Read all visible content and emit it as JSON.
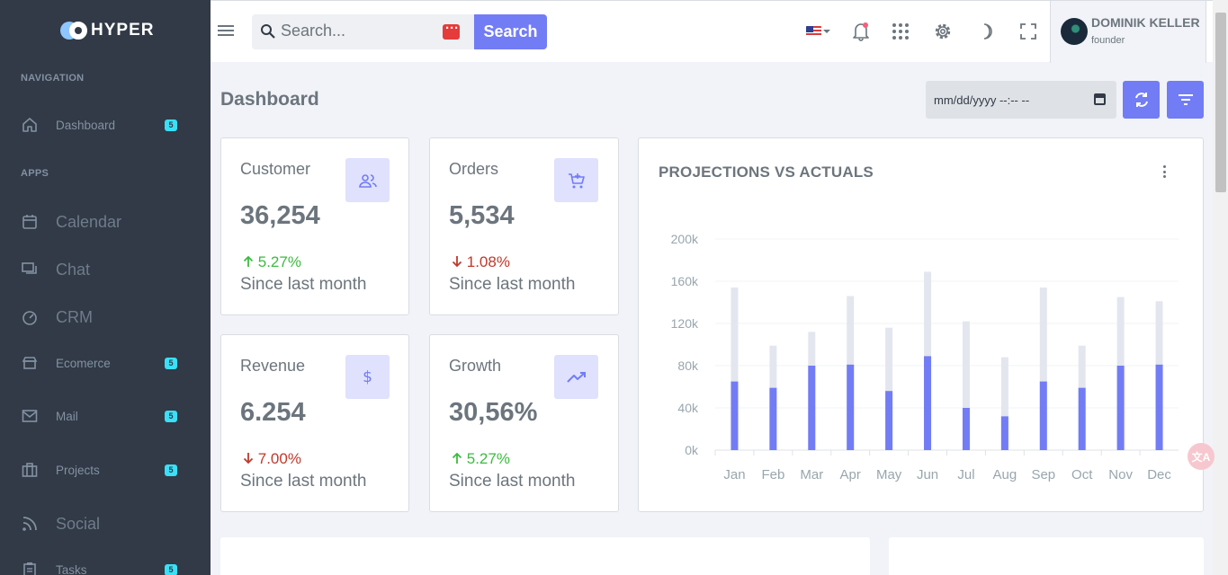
{
  "app": {
    "name": "HYPER"
  },
  "sidebar": {
    "sections": [
      "NAVIGATION",
      "APPS"
    ],
    "items": [
      {
        "label": "Dashboard",
        "icon": "home-icon",
        "badge": "5"
      },
      {
        "label": "Calendar",
        "icon": "calendar-icon"
      },
      {
        "label": "Chat",
        "icon": "chat-icon"
      },
      {
        "label": "CRM",
        "icon": "speedometer-icon"
      },
      {
        "label": "Ecomerce",
        "icon": "store-icon",
        "badge": "5"
      },
      {
        "label": "Mail",
        "icon": "mail-icon",
        "badge": "5"
      },
      {
        "label": "Projects",
        "icon": "briefcase-icon",
        "badge": "5"
      },
      {
        "label": "Social",
        "icon": "rss-icon"
      },
      {
        "label": "Tasks",
        "icon": "clipboard-icon",
        "badge": "5"
      }
    ]
  },
  "topbar": {
    "search_placeholder": "Search...",
    "search_button": "Search",
    "user": {
      "name": "DOMINIK KELLER",
      "role": "founder"
    }
  },
  "page": {
    "title": "Dashboard",
    "date_placeholder": "mm/dd/yyyy --:-- --"
  },
  "stats": [
    {
      "label": "Customer",
      "value": "36,254",
      "change": "5.27%",
      "direction": "up",
      "since": "Since last month",
      "icon": "users-icon"
    },
    {
      "label": "Orders",
      "value": "5,534",
      "change": "1.08%",
      "direction": "down",
      "since": "Since last month",
      "icon": "cart-icon"
    },
    {
      "label": "Revenue",
      "value": "6.254",
      "change": "7.00%",
      "direction": "down",
      "since": "Since last month",
      "icon": "dollar-icon"
    },
    {
      "label": "Growth",
      "value": "30,56%",
      "change": "5.27%",
      "direction": "up",
      "since": "Since last month",
      "icon": "trend-icon"
    }
  ],
  "colors": {
    "accent": "#727cf5",
    "sidebar": "#313a46",
    "up": "#3cbb40",
    "down": "#c0392b",
    "projection": "#e3e6ee"
  },
  "chart_data": {
    "type": "bar",
    "title": "PROJECTIONS VS ACTUALS",
    "categories": [
      "Jan",
      "Feb",
      "Mar",
      "Apr",
      "May",
      "Jun",
      "Jul",
      "Aug",
      "Sep",
      "Oct",
      "Nov",
      "Dec"
    ],
    "series": [
      {
        "values": [
          65000,
          59000,
          80000,
          81000,
          56000,
          89000,
          40000,
          32000,
          65000,
          59000,
          80000,
          81000
        ]
      },
      {
        "values": [
          154000,
          99000,
          112000,
          146000,
          116000,
          169000,
          122000,
          88000,
          154000,
          99000,
          145000,
          141000
        ]
      }
    ],
    "yticks": [
      "0k",
      "40k",
      "80k",
      "120k",
      "160k",
      "200k"
    ],
    "ylim": [
      0,
      200000
    ],
    "grid": true
  }
}
